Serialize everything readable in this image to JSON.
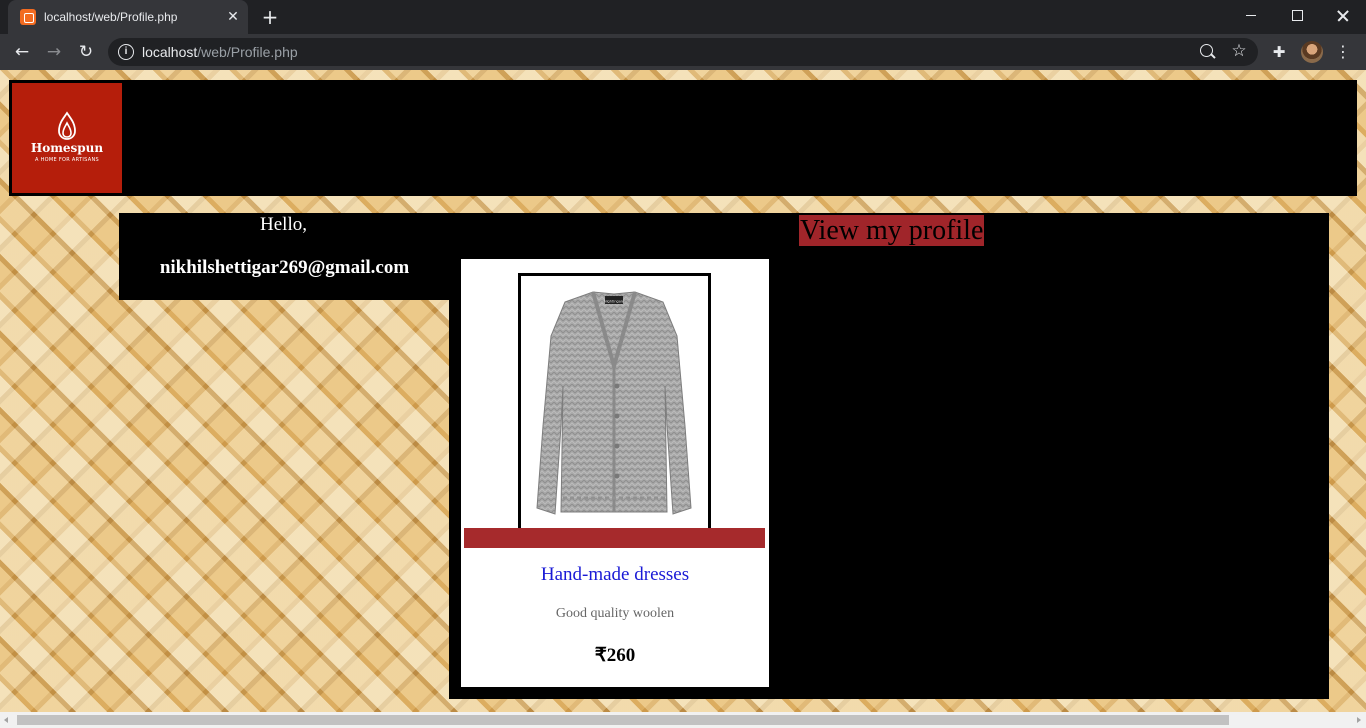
{
  "browser": {
    "tab_title": "localhost/web/Profile.php",
    "tab_close_icon": "✕",
    "new_tab_icon": "+",
    "back_icon": "←",
    "forward_icon": "→",
    "reload_icon": "↻",
    "info_icon": "i",
    "url_host": "localhost",
    "url_path": "/web/Profile.php",
    "star_icon": "☆",
    "extensions_icon": "✚",
    "menu_icon": "⋮"
  },
  "site": {
    "logo_name": "Homespun",
    "logo_tagline": "A HOME FOR ARTISANS",
    "brand_color": "#b51e0b"
  },
  "greeting": {
    "hello": "Hello,",
    "email": "nikhilshettigar269@gmail.com"
  },
  "profile_link": {
    "label": "View my profile",
    "color": "#a0252a"
  },
  "product": {
    "title": "Hand-made dresses",
    "description": "Good quality woolen",
    "price": "₹260",
    "image_label": "Nightingale",
    "accent_color": "#a62a2c",
    "title_color": "#1a1ad6"
  },
  "scrollbar": {
    "visible_fraction": 0.91
  }
}
